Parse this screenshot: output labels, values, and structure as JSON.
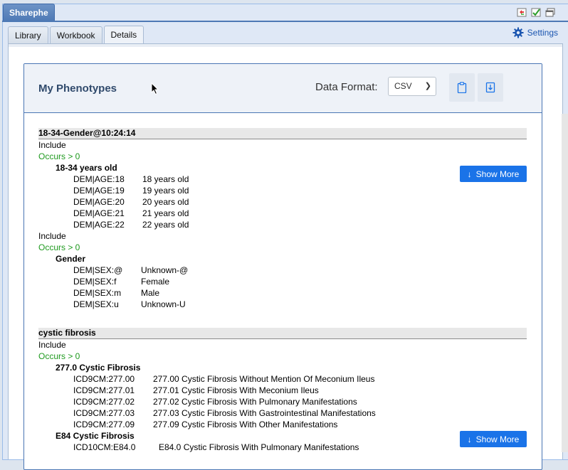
{
  "app": {
    "tab_title": "Sharephe"
  },
  "tabs": [
    {
      "label": "Library"
    },
    {
      "label": "Workbook"
    },
    {
      "label": "Details"
    }
  ],
  "settings_label": "Settings",
  "card": {
    "title": "My Phenotypes",
    "data_format_label": "Data Format:",
    "data_format_value": "CSV"
  },
  "show_more_label": "Show More",
  "phenotypes": [
    {
      "title": "18-34-Gender@10:24:14",
      "groups": [
        {
          "include": "Include",
          "occurs": "Occurs > 0",
          "name": "18-34 years old",
          "codes": [
            {
              "code": "DEM|AGE:18",
              "desc": "18 years old"
            },
            {
              "code": "DEM|AGE:19",
              "desc": "19 years old"
            },
            {
              "code": "DEM|AGE:20",
              "desc": "20 years old"
            },
            {
              "code": "DEM|AGE:21",
              "desc": "21 years old"
            },
            {
              "code": "DEM|AGE:22",
              "desc": "22 years old"
            }
          ]
        },
        {
          "include": "Include",
          "occurs": "Occurs > 0",
          "name": "Gender",
          "codes": [
            {
              "code": "DEM|SEX:@",
              "desc": "Unknown-@"
            },
            {
              "code": "DEM|SEX:f",
              "desc": "Female"
            },
            {
              "code": "DEM|SEX:m",
              "desc": "Male"
            },
            {
              "code": "DEM|SEX:u",
              "desc": "Unknown-U"
            }
          ]
        }
      ]
    },
    {
      "title": "cystic fibrosis",
      "groups": [
        {
          "include": "Include",
          "occurs": "Occurs > 0",
          "name": "277.0 Cystic Fibrosis",
          "codes": [
            {
              "code": "ICD9CM:277.00",
              "desc": "277.00 Cystic Fibrosis Without Mention Of Meconium Ileus"
            },
            {
              "code": "ICD9CM:277.01",
              "desc": "277.01 Cystic Fibrosis With Meconium Ileus"
            },
            {
              "code": "ICD9CM:277.02",
              "desc": "277.02 Cystic Fibrosis With Pulmonary Manifestations"
            },
            {
              "code": "ICD9CM:277.03",
              "desc": "277.03 Cystic Fibrosis With Gastrointestinal Manifestations"
            },
            {
              "code": "ICD9CM:277.09",
              "desc": "277.09 Cystic Fibrosis With Other Manifestations"
            }
          ]
        },
        {
          "name": "E84 Cystic Fibrosis",
          "codes": [
            {
              "code": "ICD10CM:E84.0",
              "desc": "E84.0 Cystic Fibrosis With Pulmonary Manifestations"
            }
          ]
        }
      ]
    }
  ],
  "colors": {
    "accent": "#1a73e8",
    "occurs": "#1f9a1f",
    "header": "#4e79b5"
  }
}
